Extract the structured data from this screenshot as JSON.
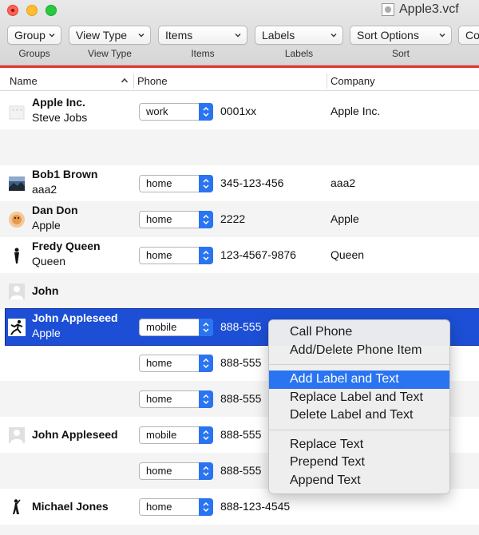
{
  "window": {
    "title": "Apple3.vcf"
  },
  "toolbar": [
    {
      "popup": "Group",
      "label": "Groups"
    },
    {
      "popup": "View Type",
      "label": "View Type"
    },
    {
      "popup": "Items",
      "label": "Items"
    },
    {
      "popup": "Labels",
      "label": "Labels"
    },
    {
      "popup": "Sort Options",
      "label": "Sort"
    },
    {
      "popup": "Co",
      "label": ""
    }
  ],
  "columns": {
    "name": "Name",
    "phone": "Phone",
    "company": "Company"
  },
  "rows": [
    {
      "name": "Apple Inc.",
      "sub": "Steve Jobs",
      "label": "work",
      "phone": "0001xx",
      "company": "Apple Inc.",
      "avatar": "building-icon"
    },
    {
      "name": "",
      "sub": "",
      "label": "",
      "phone": "",
      "company": "",
      "avatar": ""
    },
    {
      "name": "Bob1 Brown",
      "sub": "aaa2",
      "label": "home",
      "phone": "345-123-456",
      "company": "aaa2",
      "avatar": "photo-landscape-icon"
    },
    {
      "name": "Dan Don",
      "sub": "Apple",
      "label": "home",
      "phone": "2222",
      "company": "Apple",
      "avatar": "photo-face-icon"
    },
    {
      "name": "Fredy Queen",
      "sub": "Queen",
      "label": "home",
      "phone": "123-4567-9876",
      "company": "Queen",
      "avatar": "silhouette-icon"
    },
    {
      "name": "John",
      "sub": "",
      "label": "",
      "phone": "",
      "company": "",
      "avatar": "person-placeholder-icon"
    },
    {
      "name": "John Appleseed",
      "sub": "Apple",
      "label": "mobile",
      "phone": "888-555",
      "company": "",
      "avatar": "runner-icon"
    },
    {
      "name": "",
      "sub": "",
      "label": "home",
      "phone": "888-555",
      "company": "",
      "avatar": ""
    },
    {
      "name": "",
      "sub": "",
      "label": "home",
      "phone": "888-555",
      "company": "",
      "avatar": ""
    },
    {
      "name": "John Appleseed",
      "sub": "",
      "label": "mobile",
      "phone": "888-555",
      "company": "",
      "avatar": "person-placeholder-icon"
    },
    {
      "name": "",
      "sub": "",
      "label": "home",
      "phone": "888-555",
      "company": "",
      "avatar": ""
    },
    {
      "name": "Michael Jones",
      "sub": "",
      "label": "home",
      "phone": "888-123-4545",
      "company": "",
      "avatar": "dancer-icon"
    }
  ],
  "context_menu": {
    "group1": [
      "Call Phone",
      "Add/Delete Phone Item"
    ],
    "group2": [
      "Add Label and Text",
      "Replace Label and Text",
      "Delete Label and Text"
    ],
    "group3": [
      "Replace Text",
      "Prepend Text",
      "Append Text"
    ],
    "highlighted": "Add Label and Text"
  },
  "colors": {
    "selection": "#1c4fd6",
    "accent": "#2a74f2",
    "close": "#fe5f57",
    "minimize": "#febc2e",
    "zoom": "#28c840",
    "redline": "#e4382e"
  }
}
